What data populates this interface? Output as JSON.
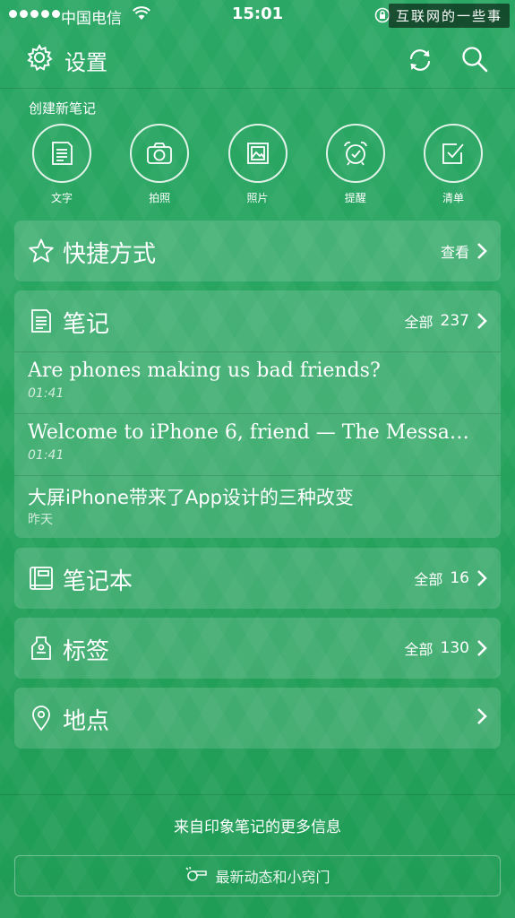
{
  "status_bar": {
    "carrier": "中国电信",
    "time": "15:01",
    "watermark": "互联网的一些事"
  },
  "header": {
    "settings_label": "设置",
    "settings_icon": "gear-icon",
    "sync_icon": "sync-icon",
    "search_icon": "search-icon"
  },
  "create": {
    "title": "创建新笔记",
    "items": [
      {
        "label": "文字",
        "icon": "text-note-icon"
      },
      {
        "label": "拍照",
        "icon": "camera-icon"
      },
      {
        "label": "照片",
        "icon": "photo-icon"
      },
      {
        "label": "提醒",
        "icon": "alarm-icon"
      },
      {
        "label": "清单",
        "icon": "checklist-icon"
      }
    ]
  },
  "shortcuts": {
    "title": "快捷方式",
    "action": "查看"
  },
  "notes": {
    "title": "笔记",
    "all_label": "全部",
    "count": "237",
    "items": [
      {
        "title": "Are phones making us bad friends?",
        "time": "01:41"
      },
      {
        "title": "Welcome to iPhone 6, friend — The Messa…",
        "time": "01:41"
      },
      {
        "title": "大屏iPhone带来了App设计的三种改变",
        "time": "昨天"
      }
    ]
  },
  "notebooks": {
    "title": "笔记本",
    "all_label": "全部",
    "count": "16"
  },
  "tags": {
    "title": "标签",
    "all_label": "全部",
    "count": "130"
  },
  "places": {
    "title": "地点"
  },
  "footer": {
    "info_text": "来自印象笔记的更多信息",
    "button_label": "最新动态和小窍门"
  },
  "colors": {
    "background": "#23a05a",
    "card": "rgba(255,255,255,0.14)",
    "text": "#ffffff"
  }
}
